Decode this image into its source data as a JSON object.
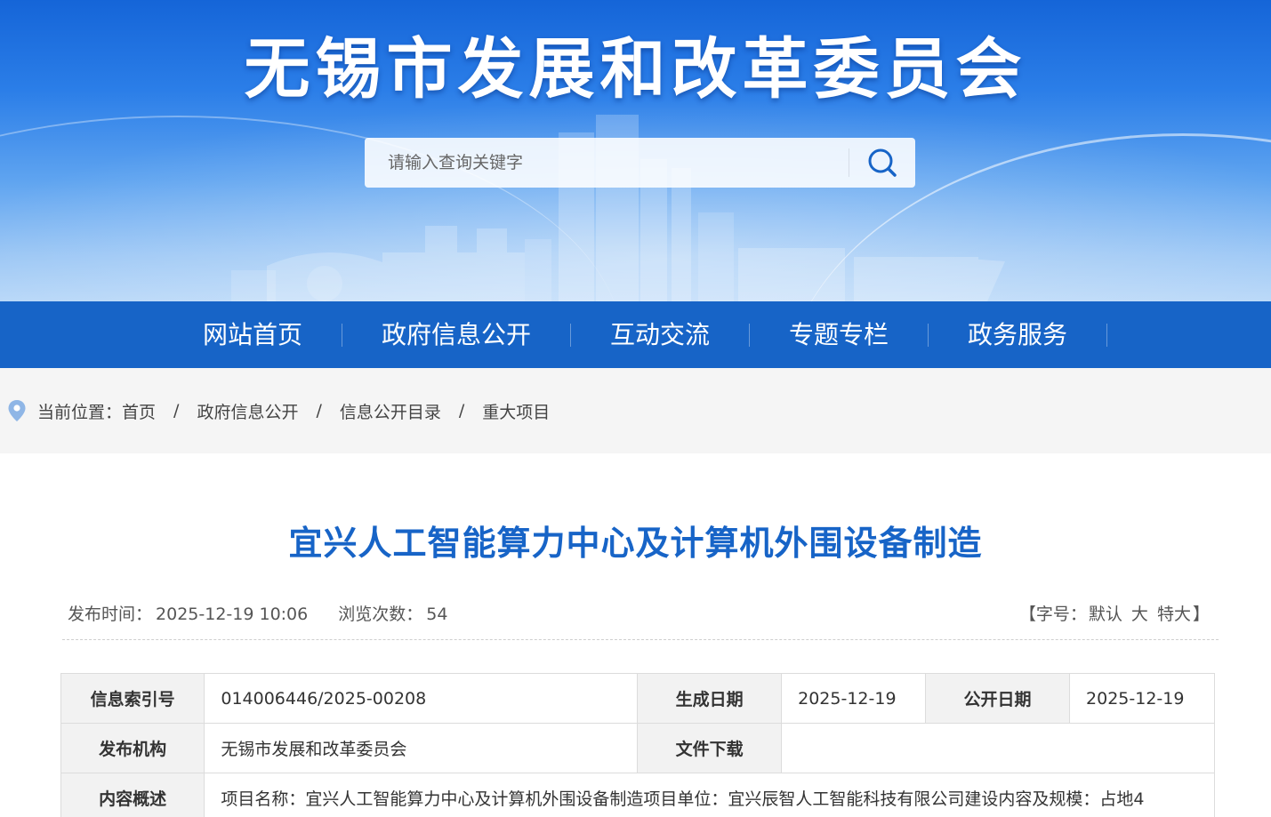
{
  "header": {
    "site_title": "无锡市发展和改革委员会",
    "search_placeholder": "请输入查询关键字"
  },
  "nav": {
    "items": [
      "网站首页",
      "政府信息公开",
      "互动交流",
      "专题专栏",
      "政务服务"
    ]
  },
  "breadcrumb": {
    "prefix": "当前位置：",
    "items": [
      "首页",
      "政府信息公开",
      "信息公开目录",
      "重大项目"
    ],
    "separator": "/"
  },
  "article": {
    "title": "宜兴人工智能算力中心及计算机外围设备制造",
    "publish_label": "发布时间：",
    "publish_time": "2025-12-19 10:06",
    "views_label": "浏览次数：",
    "views": "54",
    "font_size": {
      "open": "【字号：",
      "default": "默认",
      "large": "大",
      "xlarge": "特大",
      "close": "】"
    }
  },
  "info": {
    "index_label": "信息索引号",
    "index_value": "014006446/2025-00208",
    "created_label": "生成日期",
    "created_value": "2025-12-19",
    "public_label": "公开日期",
    "public_value": "2025-12-19",
    "publisher_label": "发布机构",
    "publisher_value": "无锡市发展和改革委员会",
    "download_label": "文件下载",
    "summary_label": "内容概述",
    "summary_value": "项目名称：宜兴人工智能算力中心及计算机外围设备制造项目单位：宜兴辰智人工智能科技有限公司建设内容及规模：占地4"
  },
  "colors": {
    "brand_blue": "#1764c7",
    "title_blue": "#1764c7",
    "breadcrumb_bg": "#f5f5f5"
  },
  "icons": {
    "search": "search-icon",
    "location": "location-pin-icon"
  }
}
